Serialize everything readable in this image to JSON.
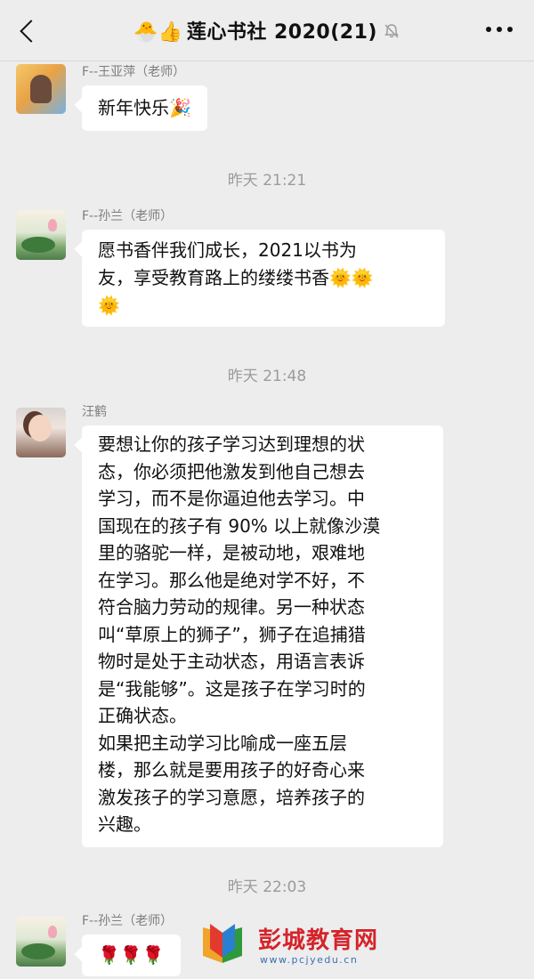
{
  "header": {
    "title_emoji": "🐣👍",
    "title": "莲心书社 2020(21)"
  },
  "messages": [
    {
      "sender": "F--王亚萍（老师）",
      "text": "新年快乐🎉"
    },
    {
      "timestamp": "昨天 21:21"
    },
    {
      "sender": "F--孙兰（老师）",
      "lines": [
        "愿书香伴我们成长，2021以书为",
        "友，享受教育路上的缕缕书香🌞🌞",
        "🌞"
      ]
    },
    {
      "timestamp": "昨天 21:48"
    },
    {
      "sender": "汪鹤",
      "lines": [
        "要想让你的孩子学习达到理想的状",
        "态，你必须把他激发到他自己想去",
        "学习，而不是你逼迫他去学习。中",
        "国现在的孩子有 90% 以上就像沙漠",
        "里的骆驼一样，是被动地，艰难地",
        "在学习。那么他是绝对学不好，不",
        "符合脑力劳动的规律。另一种状态",
        "叫“草原上的狮子”，狮子在追捕猎",
        "物时是处于主动状态，用语言表诉",
        "是“我能够”。这是孩子在学习时的",
        "正确状态。",
        "如果把主动学习比喻成一座五层",
        "楼，那么就是要用孩子的好奇心来",
        "激发孩子的学习意愿，培养孩子的",
        "兴趣。"
      ]
    },
    {
      "timestamp": "昨天 22:03"
    },
    {
      "sender": "F--孙兰（老师）",
      "text": "🌹🌹🌹"
    }
  ],
  "watermark": {
    "brand": "彭城教育网",
    "url": "www.pcjyedu.cn"
  }
}
